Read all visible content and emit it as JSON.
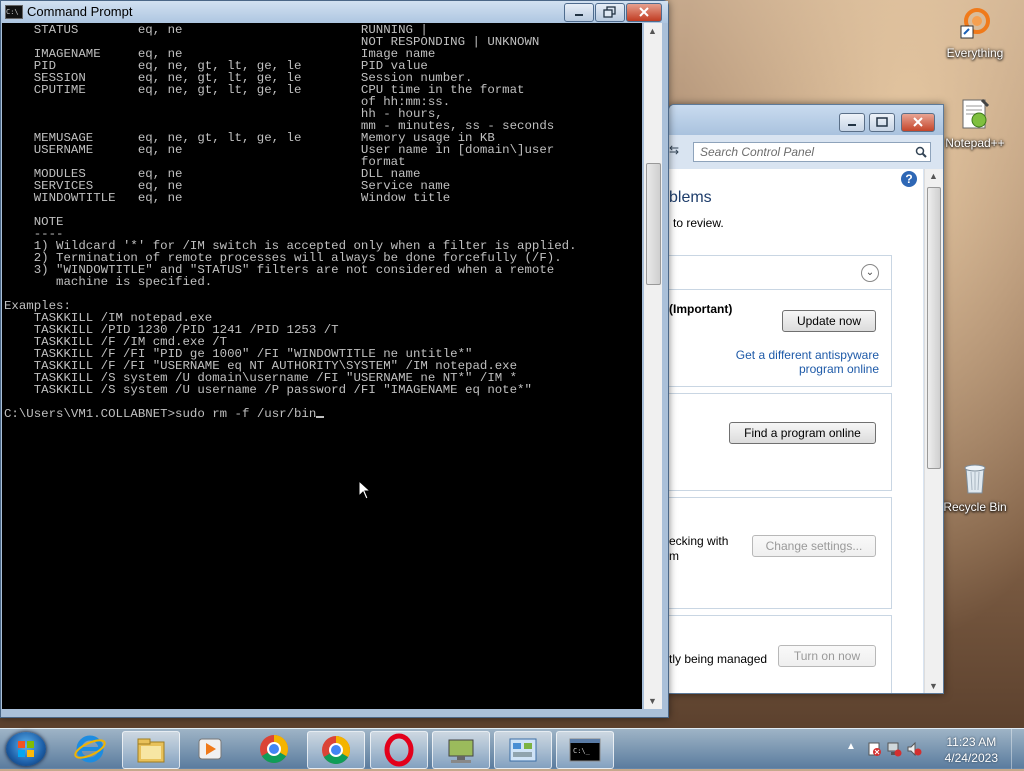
{
  "cmd": {
    "title": "Command Prompt",
    "lines": [
      "    STATUS        eq, ne                        RUNNING |",
      "                                                NOT RESPONDING | UNKNOWN",
      "    IMAGENAME     eq, ne                        Image name",
      "    PID           eq, ne, gt, lt, ge, le        PID value",
      "    SESSION       eq, ne, gt, lt, ge, le        Session number.",
      "    CPUTIME       eq, ne, gt, lt, ge, le        CPU time in the format",
      "                                                of hh:mm:ss.",
      "                                                hh - hours,",
      "                                                mm - minutes, ss - seconds",
      "    MEMUSAGE      eq, ne, gt, lt, ge, le        Memory usage in KB",
      "    USERNAME      eq, ne                        User name in [domain\\]user",
      "                                                format",
      "    MODULES       eq, ne                        DLL name",
      "    SERVICES      eq, ne                        Service name",
      "    WINDOWTITLE   eq, ne                        Window title",
      "",
      "    NOTE",
      "    ----",
      "    1) Wildcard '*' for /IM switch is accepted only when a filter is applied.",
      "    2) Termination of remote processes will always be done forcefully (/F).",
      "    3) \"WINDOWTITLE\" and \"STATUS\" filters are not considered when a remote",
      "       machine is specified.",
      "",
      "Examples:",
      "    TASKKILL /IM notepad.exe",
      "    TASKKILL /PID 1230 /PID 1241 /PID 1253 /T",
      "    TASKKILL /F /IM cmd.exe /T",
      "    TASKKILL /F /FI \"PID ge 1000\" /FI \"WINDOWTITLE ne untitle*\"",
      "    TASKKILL /F /FI \"USERNAME eq NT AUTHORITY\\SYSTEM\" /IM notepad.exe",
      "    TASKKILL /S system /U domain\\username /FI \"USERNAME ne NT*\" /IM *",
      "    TASKKILL /S system /U username /P password /FI \"IMAGENAME eq note*\"",
      ""
    ],
    "prompt": "C:\\Users\\VM1.COLLABNET>",
    "command": "sudo rm -f /usr/bin"
  },
  "control_panel": {
    "search_placeholder": "Search Control Panel",
    "heading_fragment": "blems",
    "sub_fragment": "to review.",
    "important_label": "(Important)",
    "update_button": "Update now",
    "antispyware_link": "Get a different antispyware program online",
    "find_button": "Find a program online",
    "checking_text": "ecking with",
    "checking_text2": "m",
    "change_button": "Change settings...",
    "managed_text": "tly being managed",
    "turn_on_button": "Turn on now"
  },
  "desktop_icons": [
    {
      "label": "Everything",
      "icon": "everything-icon"
    },
    {
      "label": "Notepad++",
      "icon": "notepadpp-icon"
    },
    {
      "label": "Recycle Bin",
      "icon": "recycle-bin-icon"
    }
  ],
  "taskbar": {
    "time": "11:23 AM",
    "date": "4/24/2023",
    "items": [
      "internet-explorer-icon",
      "file-explorer-icon",
      "media-player-icon",
      "chrome-icon",
      "chrome-icon",
      "opera-icon",
      "network-icon",
      "control-panel-icon",
      "command-prompt-icon"
    ]
  },
  "colors": {
    "console_bg": "#000000",
    "console_fg": "#c0c0c0",
    "link": "#1e5aa8"
  }
}
